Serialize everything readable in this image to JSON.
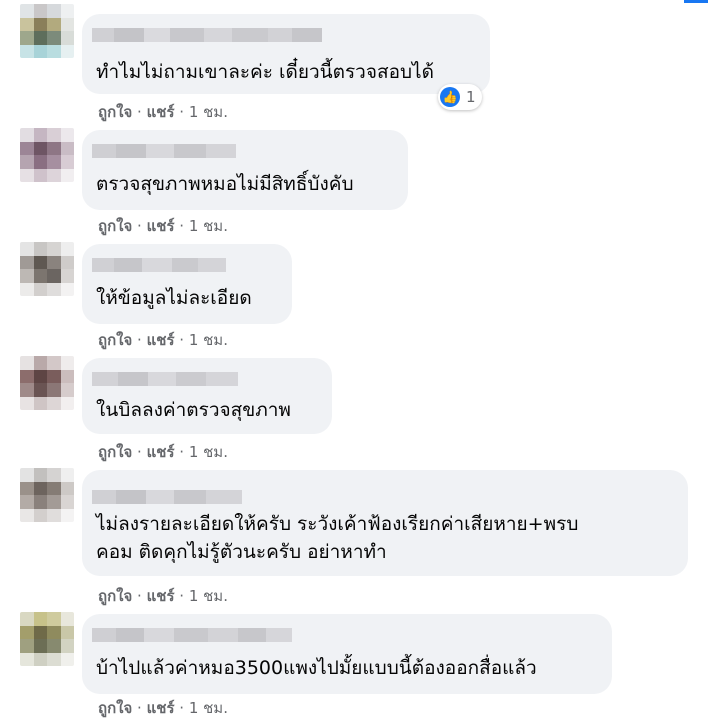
{
  "comments": [
    {
      "text": "ทำไมไม่ถามเขาละค่ะ เดี๋ยวนี้ตรวจสอบได้",
      "like": "ถูกใจ",
      "reply": "แชร์",
      "time": "1 ชม.",
      "reaction_count": "1"
    },
    {
      "text": "ตรวจสุขภาพหมอไม่มีสิทธิ์บังคับ",
      "like": "ถูกใจ",
      "reply": "แชร์",
      "time": "1 ชม."
    },
    {
      "text": "ให้ข้อมูลไม่ละเอียด",
      "like": "ถูกใจ",
      "reply": "แชร์",
      "time": "1 ชม."
    },
    {
      "text": "ในบิลลงค่าตรวจสุขภาพ",
      "like": "ถูกใจ",
      "reply": "แชร์",
      "time": "1 ชม."
    },
    {
      "text_line1": "ไม่ลงรายละเอียดให้ครับ ระวังเค้าฟ้องเรียกค่าเสียหาย+พรบ",
      "text_line2": "คอม ติดคุกไม่รู้ตัวนะครับ อย่าหาทำ",
      "like": "ถูกใจ",
      "reply": "แชร์",
      "time": "1 ชม."
    },
    {
      "text": "บ้าไปแล้วค่าหมอ3500แพงไปมั้ยแบบนี้ต้องออกสื่อแล้ว",
      "like": "ถูกใจ",
      "reply": "แชร์",
      "time": "1 ชม."
    }
  ],
  "colors": {
    "bubble": "#f0f2f5",
    "meta": "#65676b",
    "accent": "#1877f2"
  },
  "icons": {
    "reaction": "like-icon"
  }
}
